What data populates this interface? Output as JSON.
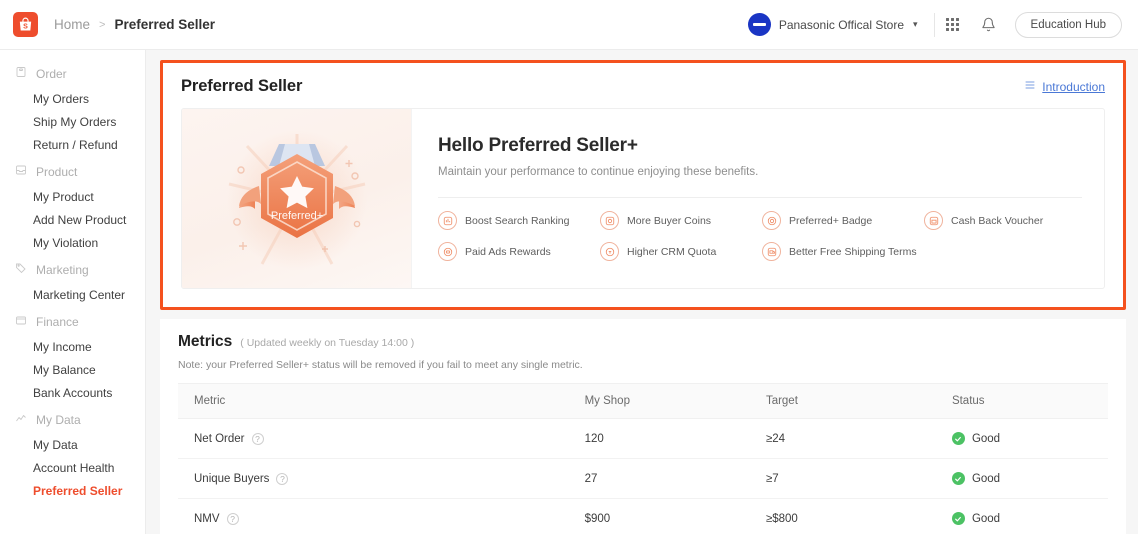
{
  "topbar": {
    "logo_icon": "shopee-bag-icon",
    "breadcrumb": {
      "home": "Home",
      "separator": ">",
      "current": "Preferred Seller"
    },
    "account": {
      "name": "Panasonic Offical Store",
      "chevron": "▾",
      "avatar_icon": "store-avatar"
    },
    "apps_icon": "grid-apps-icon",
    "notification_icon": "bell-icon",
    "education_button": "Education Hub"
  },
  "sidebar": {
    "groups": [
      {
        "label": "Order",
        "icon": "clipboard-icon",
        "items": [
          {
            "label": "My Orders",
            "active": false
          },
          {
            "label": "Ship My Orders",
            "active": false
          },
          {
            "label": "Return / Refund",
            "active": false
          }
        ]
      },
      {
        "label": "Product",
        "icon": "inbox-icon",
        "items": [
          {
            "label": "My Product",
            "active": false
          },
          {
            "label": "Add New Product",
            "active": false
          },
          {
            "label": "My Violation",
            "active": false
          }
        ]
      },
      {
        "label": "Marketing",
        "icon": "tag-icon",
        "items": [
          {
            "label": "Marketing Center",
            "active": false
          }
        ]
      },
      {
        "label": "Finance",
        "icon": "wallet-icon",
        "items": [
          {
            "label": "My Income",
            "active": false
          },
          {
            "label": "My Balance",
            "active": false
          },
          {
            "label": "Bank Accounts",
            "active": false
          }
        ]
      },
      {
        "label": "My Data",
        "icon": "chart-line-icon",
        "items": [
          {
            "label": "My Data",
            "active": false
          },
          {
            "label": "Account Health",
            "active": false
          },
          {
            "label": "Preferred Seller",
            "active": true
          }
        ]
      }
    ]
  },
  "page": {
    "title": "Preferred Seller",
    "introduction_link": "Introduction",
    "introduction_icon": "list-lines-icon",
    "highlight_color": "#f4511e"
  },
  "hero": {
    "badge_text": "Preferred+",
    "badge_icon": "star-badge-medal",
    "heading": "Hello Preferred Seller+",
    "subheading": "Maintain your performance to continue enjoying these benefits.",
    "benefits": [
      {
        "label": "Boost Search Ranking",
        "icon": "ranking-icon"
      },
      {
        "label": "More Buyer Coins",
        "icon": "coins-icon"
      },
      {
        "label": "Preferred+ Badge",
        "icon": "badge-icon"
      },
      {
        "label": "Cash Back Voucher",
        "icon": "voucher-icon"
      },
      {
        "label": "Paid Ads Rewards",
        "icon": "ads-icon"
      },
      {
        "label": "Higher CRM Quota",
        "icon": "crm-icon"
      },
      {
        "label": "Better Free Shipping Terms",
        "icon": "shipping-icon"
      }
    ]
  },
  "metrics": {
    "title": "Metrics",
    "updated_note": "( Updated weekly on Tuesday 14:00 )",
    "note": "Note: your Preferred Seller+ status will be removed if you fail to meet any single metric.",
    "columns": [
      "Metric",
      "My Shop",
      "Target",
      "Status"
    ],
    "rows": [
      {
        "metric": "Net Order",
        "my_shop": "120",
        "target": "≥24",
        "status": "Good"
      },
      {
        "metric": "Unique Buyers",
        "my_shop": "27",
        "target": "≥7",
        "status": "Good"
      },
      {
        "metric": "NMV",
        "my_shop": "$900",
        "target": "≥$800",
        "status": "Good"
      }
    ],
    "status_ok_color": "#4cc264",
    "help_icon": "question-circle-icon"
  }
}
